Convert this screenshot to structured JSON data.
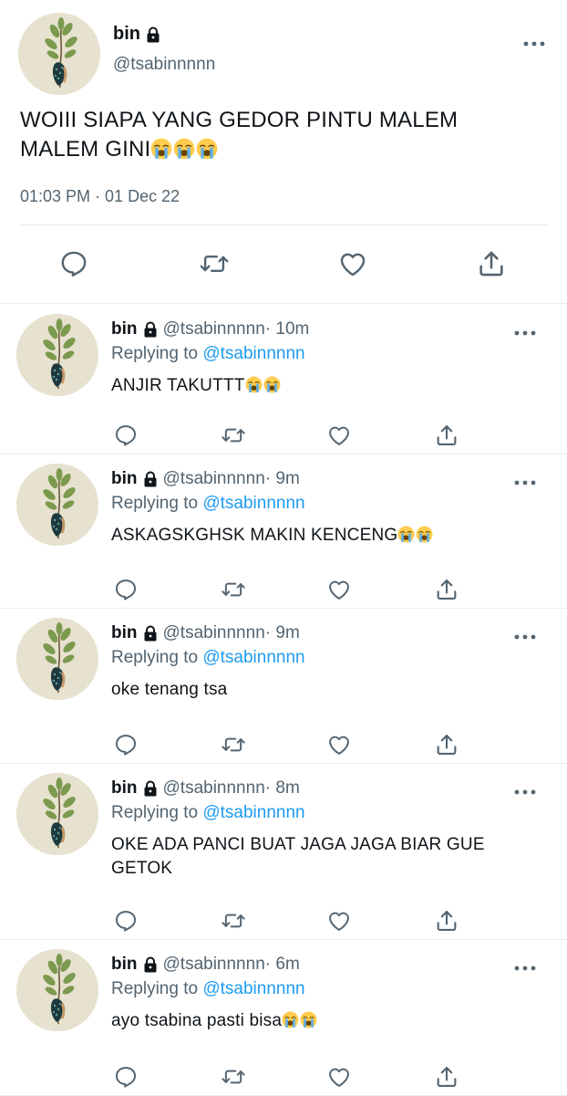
{
  "main": {
    "name": "bin",
    "handle": "@tsabinnnnn",
    "text": "WOIII SIAPA YANG GEDOR PINTU MALEM MALEM GINI",
    "emojis": 3,
    "timestamp": "01:03 PM · 01 Dec 22"
  },
  "replies": [
    {
      "name": "bin",
      "handle": "@tsabinnnnn",
      "time": " · 10m",
      "replying_label": "Replying to",
      "replying_to": "@tsabinnnnn",
      "text": "ANJIR TAKUTTT",
      "emojis": 2
    },
    {
      "name": "bin",
      "handle": "@tsabinnnnn",
      "time": " · 9m",
      "replying_label": "Replying to",
      "replying_to": "@tsabinnnnn",
      "text": "ASKAGSKGHSK MAKIN KENCENG",
      "emojis": 2
    },
    {
      "name": "bin",
      "handle": "@tsabinnnnn",
      "time": " · 9m",
      "replying_label": "Replying to",
      "replying_to": "@tsabinnnnn",
      "text": "oke tenang tsa",
      "emojis": 0
    },
    {
      "name": "bin",
      "handle": "@tsabinnnnn",
      "time": " · 8m",
      "replying_label": "Replying to",
      "replying_to": "@tsabinnnnn",
      "text": "OKE ADA PANCI BUAT JAGA JAGA BIAR GUE GETOK",
      "emojis": 0
    },
    {
      "name": "bin",
      "handle": "@tsabinnnnn",
      "time": " · 6m",
      "replying_label": "Replying to",
      "replying_to": "@tsabinnnnn",
      "text": "ayo tsabina pasti bisa",
      "emojis": 2
    }
  ],
  "icons": {
    "reply": "reply-icon",
    "retweet": "retweet-icon",
    "like": "heart-icon",
    "share": "share-icon",
    "more": "more-icon",
    "lock": "lock-icon",
    "emoji": "loudly-crying-face-emoji"
  },
  "colors": {
    "text": "#0f1419",
    "secondary": "#536471",
    "link": "#1d9bf0",
    "divider": "#e6ecf0",
    "avatar_bg": "#e7e2cf"
  }
}
